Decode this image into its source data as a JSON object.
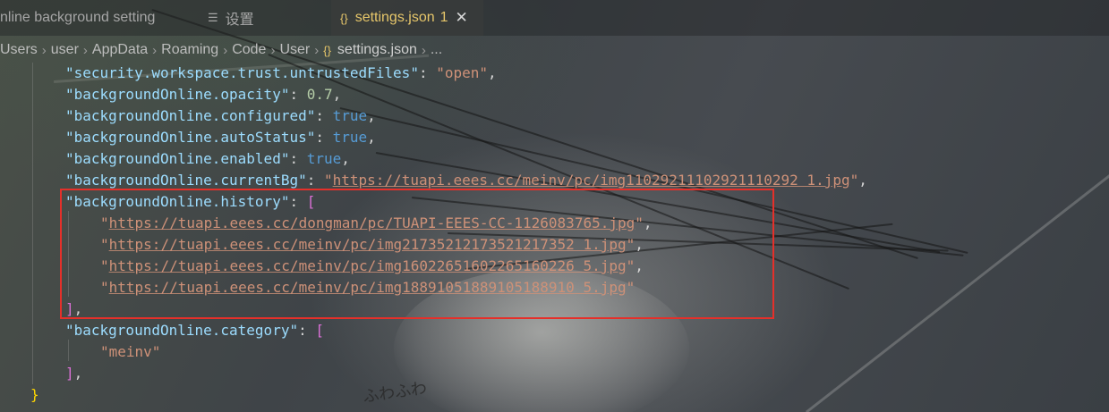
{
  "tabs": [
    {
      "label": "nline background setting",
      "active": false
    },
    {
      "icon": "settings-list-icon",
      "label": "设置",
      "active": false
    },
    {
      "icon": "json-braces-icon",
      "label": "settings.json",
      "badge": "1",
      "active": true,
      "close": "✕"
    }
  ],
  "breadcrumb": {
    "items": [
      "Users",
      "user",
      "AppData",
      "Roaming",
      "Code",
      "User"
    ],
    "file": "settings.json",
    "more": "..."
  },
  "code": {
    "l1_key": "\"security.workspace.trust.untrustedFiles\"",
    "l1_val": "\"open\"",
    "l2_key": "\"backgroundOnline.opacity\"",
    "l2_val": "0.7",
    "l3_key": "\"backgroundOnline.configured\"",
    "l3_val": "true",
    "l4_key": "\"backgroundOnline.autoStatus\"",
    "l4_val": "true",
    "l5_key": "\"backgroundOnline.enabled\"",
    "l5_val": "true",
    "l6_key": "\"backgroundOnline.currentBg\"",
    "l6_url": "https://tuapi.eees.cc/meinv/pc/img11029211102921110292 1.jpg",
    "l7_key": "\"backgroundOnline.history\"",
    "history": [
      "https://tuapi.eees.cc/dongman/pc/TUAPI-EEES-CC-1126083765.jpg",
      "https://tuapi.eees.cc/meinv/pc/img21735212173521217352 1.jpg",
      "https://tuapi.eees.cc/meinv/pc/img16022651602265160226 5.jpg",
      "https://tuapi.eees.cc/meinv/pc/img18891051889105188910 5.jpg"
    ],
    "l13_key": "\"backgroundOnline.category\"",
    "category": "\"meinv\""
  },
  "colors": {
    "highlight_box": "#e5302a",
    "active_tab_text": "#e6c66a"
  }
}
